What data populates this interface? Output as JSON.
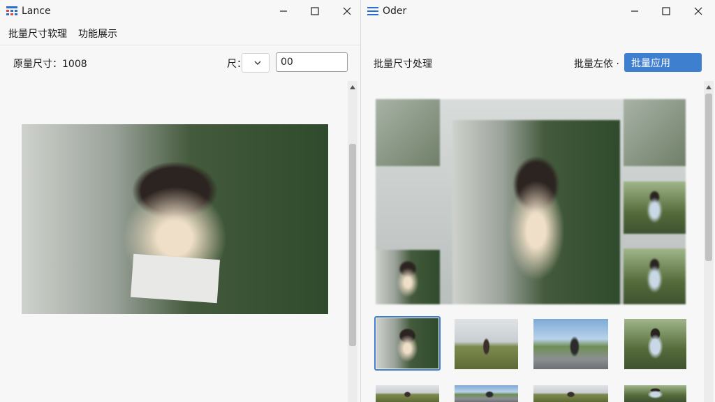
{
  "left_window": {
    "title": "Lance",
    "menu": [
      "批量尺寸软理",
      "功能展示"
    ],
    "original_size_label": "原量尺寸：1008",
    "size_label": "尺：",
    "size_input_value": "00"
  },
  "right_window": {
    "title": "Oder",
    "section_title": "批量尺寸处理",
    "batch_label": "批量左依 ·",
    "apply_button": "批量应用"
  },
  "colors": {
    "accent": "#3f7fd0",
    "window_bg": "#f7f7f7"
  },
  "icons": [
    "grid-app-icon",
    "list-app-icon",
    "minimize-icon",
    "maximize-icon",
    "close-icon",
    "chevron-down-icon",
    "scroll-up-arrow-icon"
  ]
}
